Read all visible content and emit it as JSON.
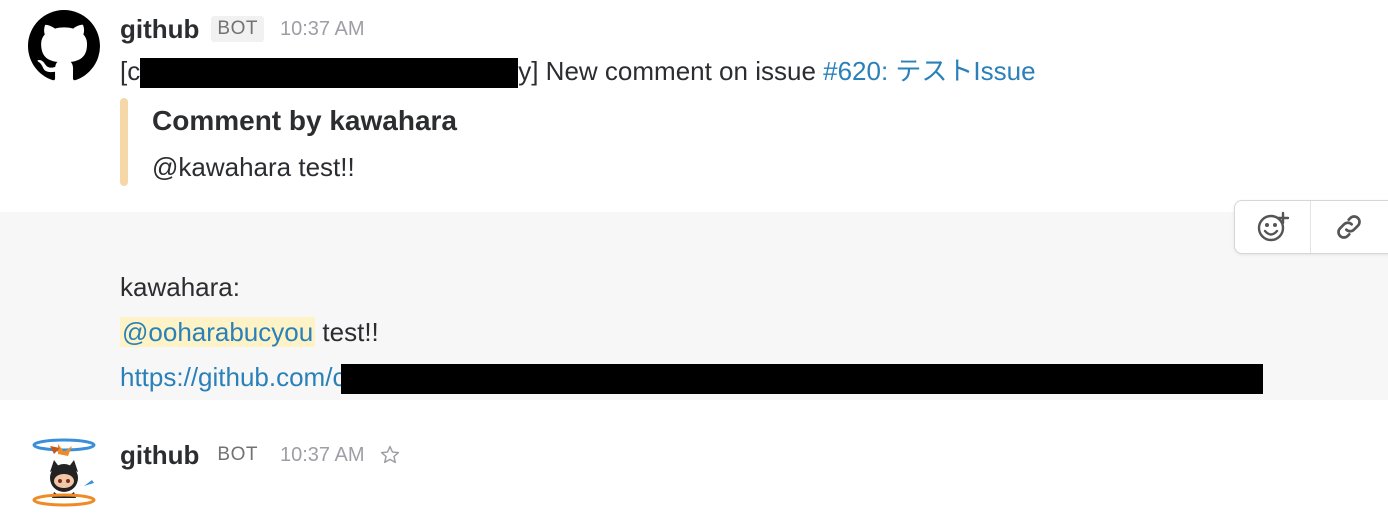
{
  "message1": {
    "sender": "github",
    "badge": "BOT",
    "time": "10:37 AM",
    "text_open_bracket": "[",
    "text_repo_start": "c",
    "text_repo_end": "y",
    "text_main": "] New comment on issue ",
    "issue_link": "#620: テストIssue",
    "attachment": {
      "title": "Comment by kawahara",
      "text": "@kawahara test!!",
      "border_color": "#f6d7a8"
    }
  },
  "message2": {
    "sender": "github",
    "badge": "BOT",
    "time": "10:37 AM",
    "line1": "kawahara:",
    "mention": "@ooharabucyou",
    "mention_suffix": " test!!",
    "url_prefix": "https://github.com/",
    "url_tail": "c"
  },
  "actions": {
    "icons": [
      "add-reaction-icon",
      "copy-link-icon"
    ]
  },
  "colors": {
    "link": "#2a80b9",
    "mention_bg": "#fdf3c6",
    "hover_bg": "#f7f7f7"
  }
}
